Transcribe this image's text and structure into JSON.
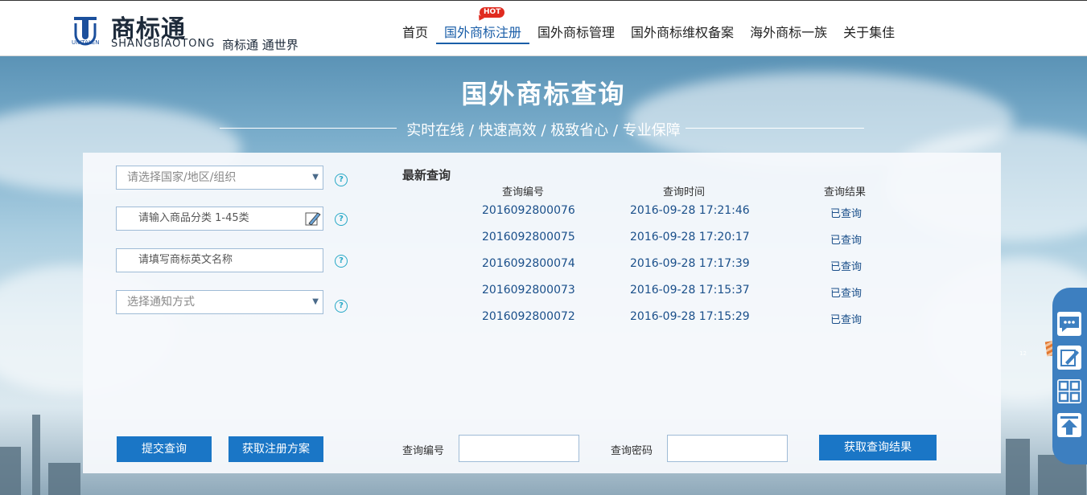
{
  "header": {
    "logo_cn": "商标通",
    "logo_en": "SHANGBIAOTONG",
    "slogan": "商标通 通世界",
    "brand_small": "UNITALEN",
    "nav": [
      {
        "label": "首页"
      },
      {
        "label": "国外商标注册",
        "badge": "HOT"
      },
      {
        "label": "国外商标管理"
      },
      {
        "label": "国外商标维权备案"
      },
      {
        "label": "海外商标一族"
      },
      {
        "label": "关于集佳"
      }
    ]
  },
  "hero": {
    "title": "国外商标查询",
    "subtitle": "实时在线 / 快速高效 / 极致省心 / 专业保障"
  },
  "form": {
    "country_placeholder": "请选择国家/地区/组织",
    "category_placeholder": "请输入商品分类 1-45类",
    "name_placeholder": "请填写商标英文名称",
    "notify_placeholder": "选择通知方式",
    "help_glyph": "?",
    "submit_label": "提交查询",
    "plan_label": "获取注册方案"
  },
  "recent": {
    "title": "最新查询",
    "headers": [
      "查询编号",
      "查询时间",
      "查询结果"
    ],
    "rows": [
      {
        "id": "2016092800076",
        "time": "2016-09-28 17:21:46",
        "result": "已查询"
      },
      {
        "id": "2016092800075",
        "time": "2016-09-28 17:20:17",
        "result": "已查询"
      },
      {
        "id": "2016092800074",
        "time": "2016-09-28 17:17:39",
        "result": "已查询"
      },
      {
        "id": "2016092800073",
        "time": "2016-09-28 17:15:37",
        "result": "已查询"
      },
      {
        "id": "2016092800072",
        "time": "2016-09-28 17:15:29",
        "result": "已查询"
      }
    ]
  },
  "lookup": {
    "number_label": "查询编号",
    "password_label": "查询密码",
    "result_button": "获取查询结果"
  },
  "sidebar": {
    "items": [
      "chat-icon",
      "edit-icon",
      "qrcode-icon",
      "back-to-top-icon"
    ]
  },
  "misc": {
    "tiny_text": "12"
  },
  "colors": {
    "accent": "#1a76c6",
    "nav_active": "#1a5ea8",
    "hot": "#e02b1f",
    "help": "#26a8c6"
  }
}
